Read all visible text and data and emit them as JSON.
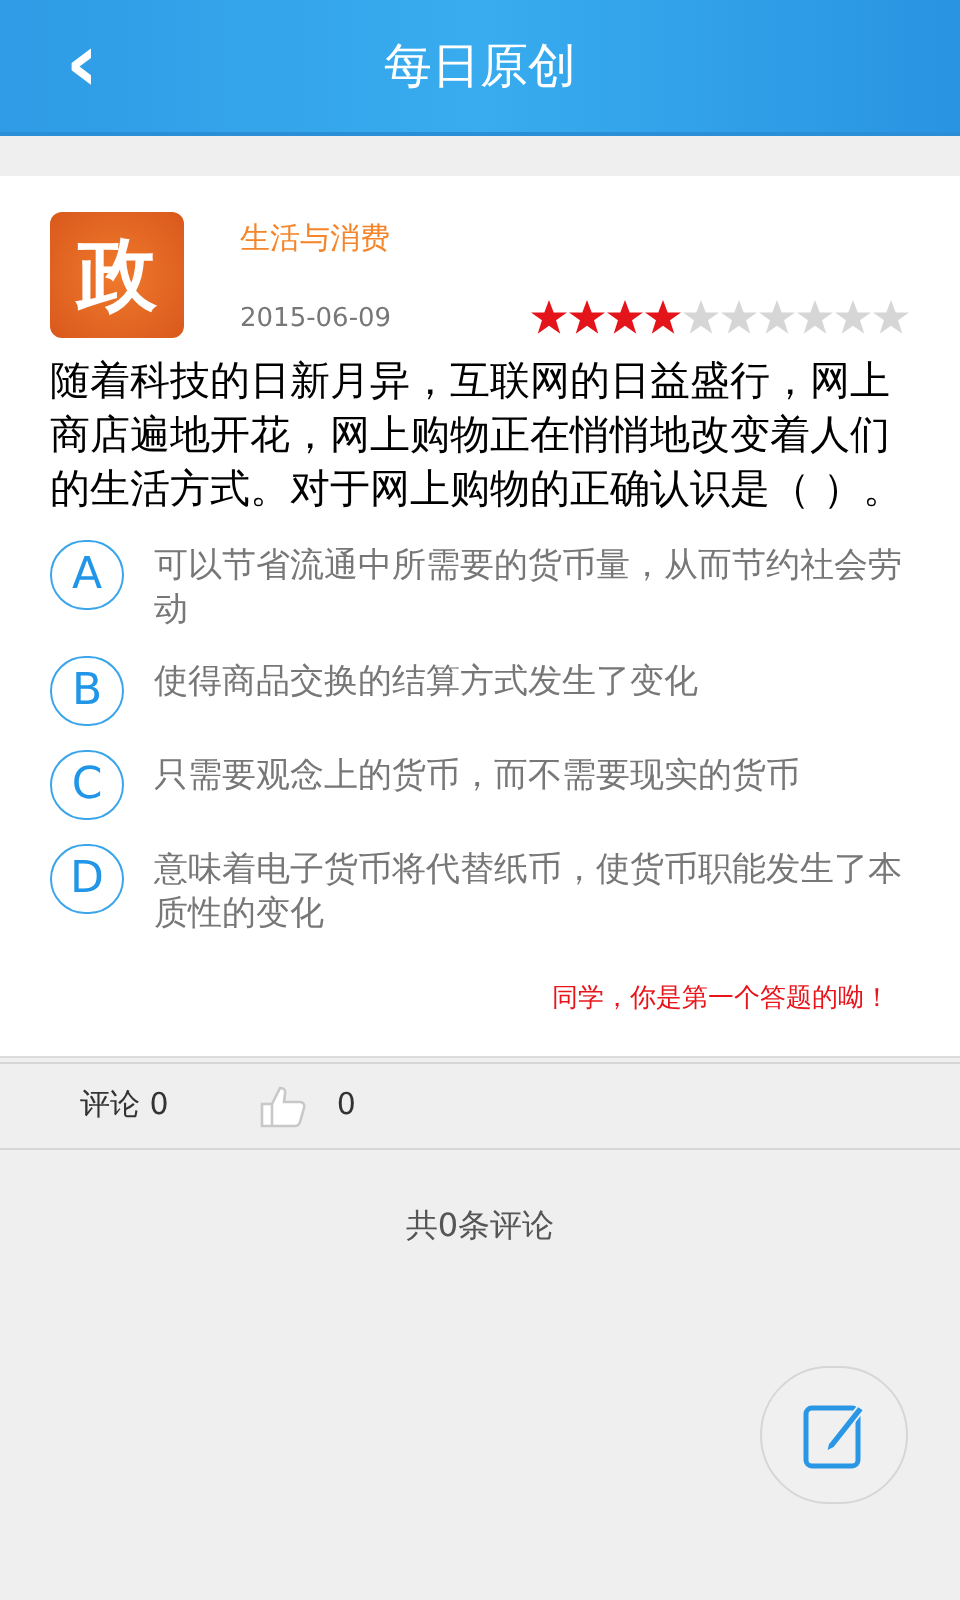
{
  "header": {
    "back": "‹",
    "title": "每日原创"
  },
  "question": {
    "subject_icon": "政",
    "category": "生活与消费",
    "date": "2015-06-09",
    "stars": 4,
    "text": "随着科技的日新月异，互联网的日益盛行，网上商店遍地开花，网上购物正在悄悄地改变着人们的生活方式。对于网上购物的正确认识是（ ）。",
    "options": [
      {
        "letter": "A",
        "text": "可以节省流通中所需要的货币量，从而节约社会劳动"
      },
      {
        "letter": "B",
        "text": "使得商品交换的结算方式发生了变化"
      },
      {
        "letter": "C",
        "text": "只需要观念上的货币，而不需要现实的货币"
      },
      {
        "letter": "D",
        "text": "意味着电子货币将代替纸币，使货币职能发生了本质性的变化"
      }
    ],
    "hint": "同学，你是第一个答题的呦！"
  },
  "stats": {
    "comments": "评论 0",
    "likes": "0"
  },
  "comment_total": "共0条评论"
}
